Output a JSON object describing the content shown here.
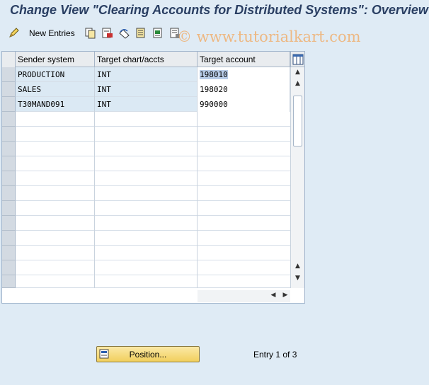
{
  "title": "Change View \"Clearing Accounts for Distributed Systems\": Overview",
  "toolbar": {
    "new_entries_label": "New Entries",
    "icons": [
      "pencil-glasses-icon",
      "copy-icon",
      "delete-icon",
      "undo-icon",
      "select-all-icon",
      "select-block-icon",
      "deselect-all-icon"
    ]
  },
  "watermark": "© www.tutorialkart.com",
  "table": {
    "columns": [
      "Sender system",
      "Target chart/accts",
      "Target account"
    ],
    "rows": [
      {
        "sender": "PRODUCTION",
        "chart": "INT",
        "account": "198010"
      },
      {
        "sender": "SALES",
        "chart": "INT",
        "account": "198020"
      },
      {
        "sender": "T30MAND091",
        "chart": "INT",
        "account": "990000"
      }
    ]
  },
  "footer": {
    "position_label": "Position...",
    "entry_info": "Entry 1 of 3"
  },
  "colors": {
    "title": "#2a3f63",
    "background": "#dfebf5",
    "row_filled": "#dbe9f4",
    "button": "#f1cf5d"
  }
}
